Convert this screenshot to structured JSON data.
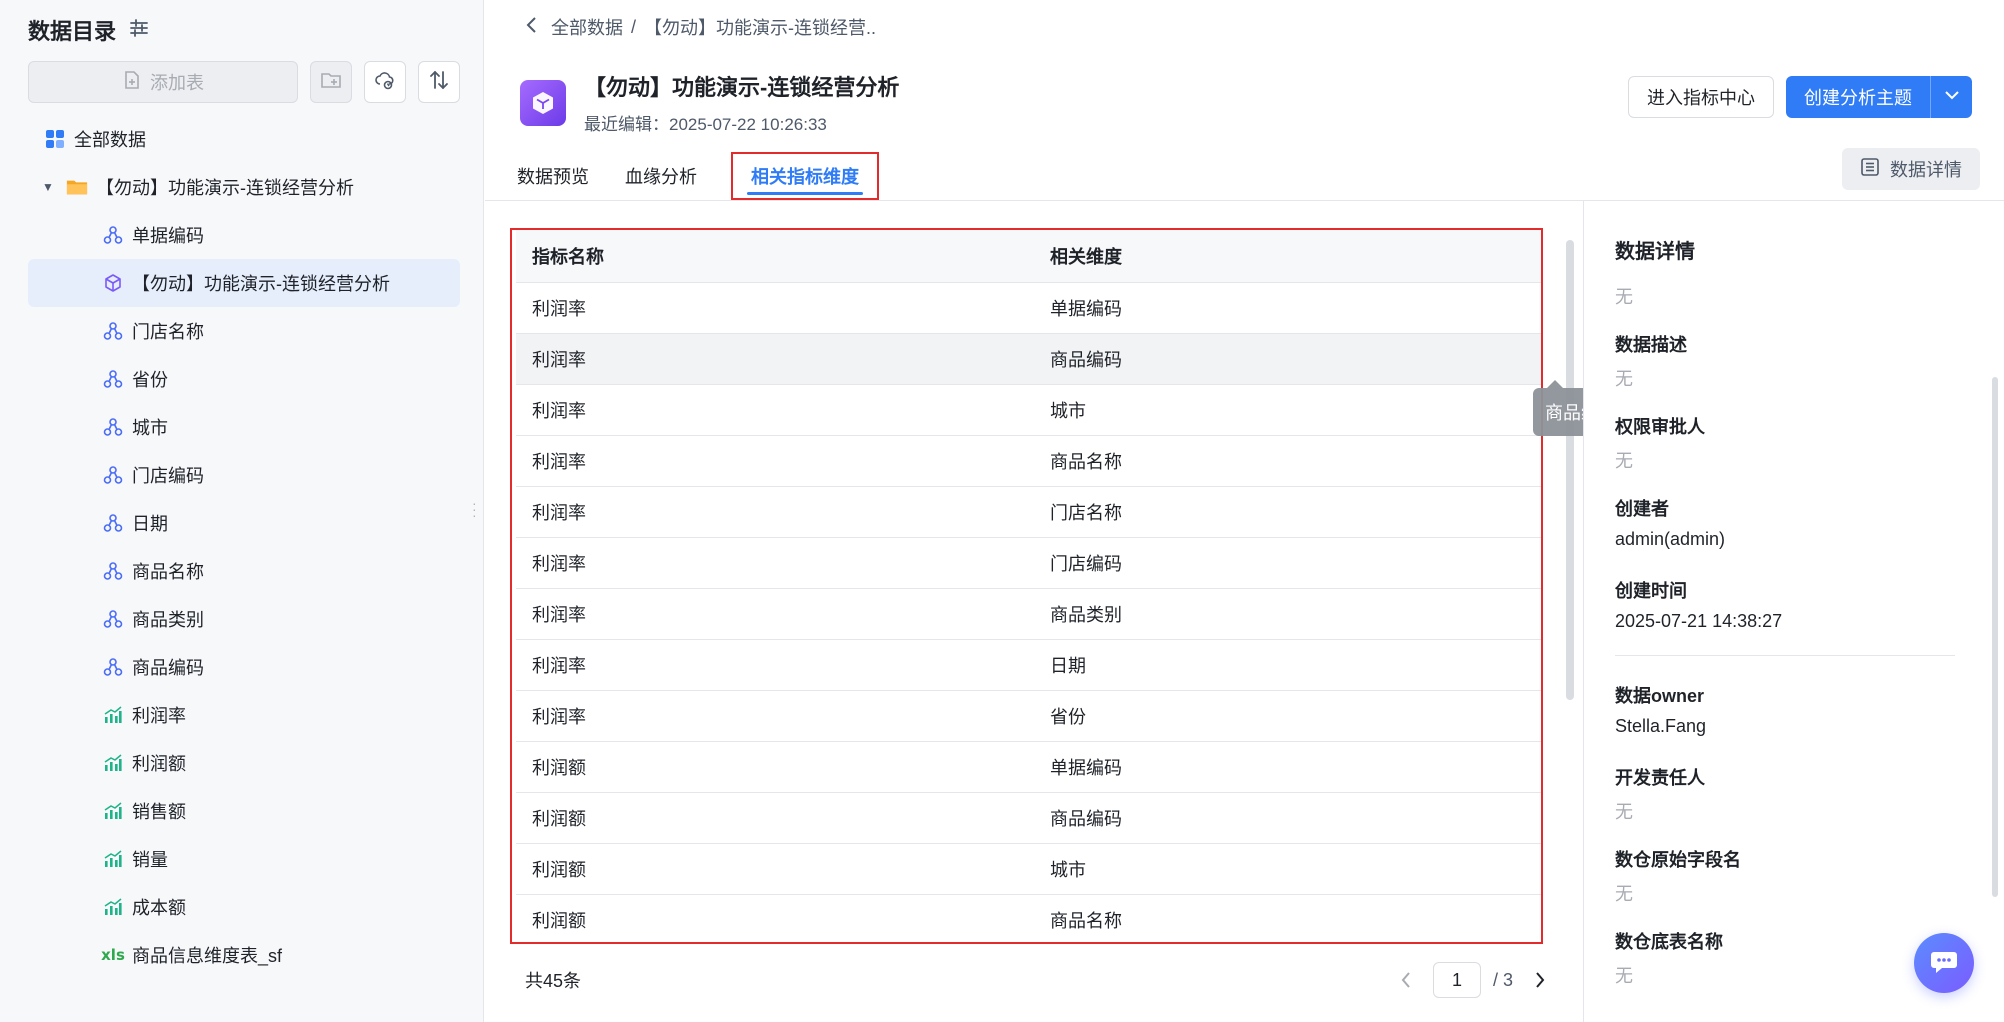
{
  "sidebar": {
    "title": "数据目录",
    "add_table_label": "添加表",
    "items": [
      {
        "label": "全部数据",
        "icon": "grid-icon",
        "level": 0
      },
      {
        "label": "【勿动】功能演示-连锁经营分析",
        "icon": "folder-icon",
        "level": 1
      },
      {
        "label": "单据编码",
        "icon": "dimension-icon",
        "level": 2
      },
      {
        "label": "【勿动】功能演示-连锁经营分析",
        "icon": "cube-icon",
        "level": 2,
        "selected": true
      },
      {
        "label": "门店名称",
        "icon": "dimension-icon",
        "level": 2
      },
      {
        "label": "省份",
        "icon": "dimension-icon",
        "level": 2
      },
      {
        "label": "城市",
        "icon": "dimension-icon",
        "level": 2
      },
      {
        "label": "门店编码",
        "icon": "dimension-icon",
        "level": 2
      },
      {
        "label": "日期",
        "icon": "dimension-icon",
        "level": 2
      },
      {
        "label": "商品名称",
        "icon": "dimension-icon",
        "level": 2
      },
      {
        "label": "商品类别",
        "icon": "dimension-icon",
        "level": 2
      },
      {
        "label": "商品编码",
        "icon": "dimension-icon",
        "level": 2
      },
      {
        "label": "利润率",
        "icon": "metric-icon",
        "level": 2
      },
      {
        "label": "利润额",
        "icon": "metric-icon",
        "level": 2
      },
      {
        "label": "销售额",
        "icon": "metric-icon",
        "level": 2
      },
      {
        "label": "销量",
        "icon": "metric-icon",
        "level": 2
      },
      {
        "label": "成本额",
        "icon": "metric-icon",
        "level": 2
      },
      {
        "label": "商品信息维度表_sf",
        "icon": "excel-icon",
        "level": 2
      }
    ]
  },
  "header": {
    "breadcrumb_root": "全部数据",
    "breadcrumb_sep": "/",
    "breadcrumb_current": "【勿动】功能演示-连锁经营..",
    "title": "【勿动】功能演示-连锁经营分析",
    "last_edit": "最近编辑：2025-07-22 10:26:33",
    "btn_metric_center": "进入指标中心",
    "btn_create_theme": "创建分析主题",
    "btn_data_detail": "数据详情"
  },
  "tabs": [
    {
      "label": "数据预览",
      "active": false
    },
    {
      "label": "血缘分析",
      "active": false
    },
    {
      "label": "相关指标维度",
      "active": true
    }
  ],
  "table": {
    "columns": [
      "指标名称",
      "相关维度"
    ],
    "rows": [
      [
        "利润率",
        "单据编码"
      ],
      [
        "利润率",
        "商品编码"
      ],
      [
        "利润率",
        "城市"
      ],
      [
        "利润率",
        "商品名称"
      ],
      [
        "利润率",
        "门店名称"
      ],
      [
        "利润率",
        "门店编码"
      ],
      [
        "利润率",
        "商品类别"
      ],
      [
        "利润率",
        "日期"
      ],
      [
        "利润率",
        "省份"
      ],
      [
        "利润额",
        "单据编码"
      ],
      [
        "利润额",
        "商品编码"
      ],
      [
        "利润额",
        "城市"
      ],
      [
        "利润额",
        "商品名称"
      ]
    ],
    "hover_row": 1,
    "tooltip": "商品编码"
  },
  "pagination": {
    "total": "共45条",
    "current_page": "1",
    "total_pages": "/ 3"
  },
  "detail_panel": {
    "title": "数据详情",
    "title_value": "无",
    "fields": [
      {
        "label": "数据描述",
        "value": "无",
        "muted": true
      },
      {
        "label": "权限审批人",
        "value": "无",
        "muted": true
      },
      {
        "label": "创建者",
        "value": "admin(admin)",
        "muted": false
      },
      {
        "label": "创建时间",
        "value": "2025-07-21 14:38:27",
        "muted": false
      }
    ],
    "fields2": [
      {
        "label": "数据owner",
        "value": "Stella.Fang",
        "muted": false
      },
      {
        "label": "开发责任人",
        "value": "无",
        "muted": true
      },
      {
        "label": "数仓原始字段名",
        "value": "无",
        "muted": true
      },
      {
        "label": "数仓底表名称",
        "value": "无",
        "muted": true
      }
    ]
  },
  "colors": {
    "primary": "#2f7cf6",
    "highlight_border": "#e32b2b",
    "dimension_icon": "#4a6cf7",
    "metric_icon": "#1fb38a",
    "excel_icon": "#2fa84f",
    "folder_icon": "#f5a623"
  }
}
